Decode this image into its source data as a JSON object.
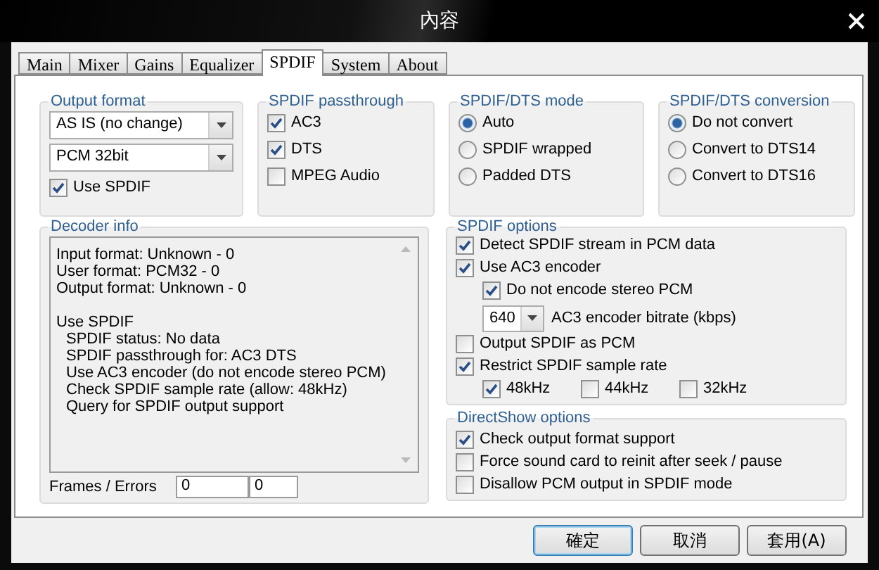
{
  "window": {
    "title": "內容"
  },
  "tabs": [
    {
      "label": "Main",
      "selected": false
    },
    {
      "label": "Mixer",
      "selected": false
    },
    {
      "label": "Gains",
      "selected": false
    },
    {
      "label": "Equalizer",
      "selected": false
    },
    {
      "label": "SPDIF",
      "selected": true
    },
    {
      "label": "System",
      "selected": false
    },
    {
      "label": "About",
      "selected": false
    }
  ],
  "output_format": {
    "title": "Output format",
    "dropdowns": [
      "AS IS (no change)",
      "PCM 32bit"
    ],
    "options": [
      {
        "label": "Use SPDIF",
        "checked": true
      }
    ]
  },
  "spdif_passthrough": {
    "title": "SPDIF passthrough",
    "options": [
      {
        "label": "AC3",
        "checked": true
      },
      {
        "label": "DTS",
        "checked": true
      },
      {
        "label": "MPEG Audio",
        "checked": false
      }
    ]
  },
  "spdif_dts_mode": {
    "title": "SPDIF/DTS mode",
    "choices": [
      {
        "label": "Auto",
        "selected": true
      },
      {
        "label": "SPDIF wrapped",
        "selected": false
      },
      {
        "label": "Padded DTS",
        "selected": false
      }
    ]
  },
  "spdif_dts_conversion": {
    "title": "SPDIF/DTS conversion",
    "choices": [
      {
        "label": "Do not convert",
        "selected": true
      },
      {
        "label": "Convert to DTS14",
        "selected": false
      },
      {
        "label": "Convert to DTS16",
        "selected": false
      }
    ]
  },
  "decoder_info": {
    "title": "Decoder info",
    "blocks": [
      {
        "lines": [
          "Input format: Unknown - 0",
          "User format: PCM32 - 0",
          "Output format: Unknown - 0"
        ]
      },
      {
        "heading": "Use SPDIF",
        "lines": [
          "SPDIF status: No data",
          "SPDIF passthrough for: AC3 DTS",
          "Use AC3 encoder (do not encode stereo PCM)",
          "Check SPDIF sample rate (allow: 48kHz)",
          "Query for SPDIF output support"
        ]
      }
    ],
    "frames_label": "Frames / Errors",
    "frames": "0",
    "errors": "0"
  },
  "spdif_options": {
    "title": "SPDIF options",
    "items": [
      {
        "kind": "checkbox",
        "label": "Detect SPDIF stream in PCM data",
        "checked": true
      },
      {
        "kind": "checkbox",
        "label": "Use AC3 encoder",
        "checked": true,
        "children": [
          {
            "kind": "checkbox",
            "label": "Do not encode stereo PCM",
            "checked": true
          },
          {
            "kind": "combo",
            "label": "AC3 encoder bitrate (kbps)",
            "value": "640"
          }
        ]
      },
      {
        "kind": "checkbox",
        "label": "Output SPDIF as PCM",
        "checked": false
      },
      {
        "kind": "checkbox",
        "label": "Restrict SPDIF sample rate",
        "checked": true,
        "children": [
          {
            "kind": "checkbox_row",
            "options": [
              {
                "label": "48kHz",
                "checked": true
              },
              {
                "label": "44kHz",
                "checked": false
              },
              {
                "label": "32kHz",
                "checked": false
              }
            ]
          }
        ]
      }
    ]
  },
  "directshow_options": {
    "title": "DirectShow options",
    "items": [
      {
        "kind": "checkbox",
        "label": "Check output format support",
        "checked": true
      },
      {
        "kind": "checkbox",
        "label": "Force sound card to reinit after seek / pause",
        "checked": false
      },
      {
        "kind": "checkbox",
        "label": "Disallow PCM output in SPDIF mode",
        "checked": false
      }
    ]
  },
  "buttons": [
    {
      "label": "確定",
      "default": true
    },
    {
      "label": "取消",
      "default": false
    },
    {
      "label": "套用(A)",
      "default": false
    }
  ]
}
